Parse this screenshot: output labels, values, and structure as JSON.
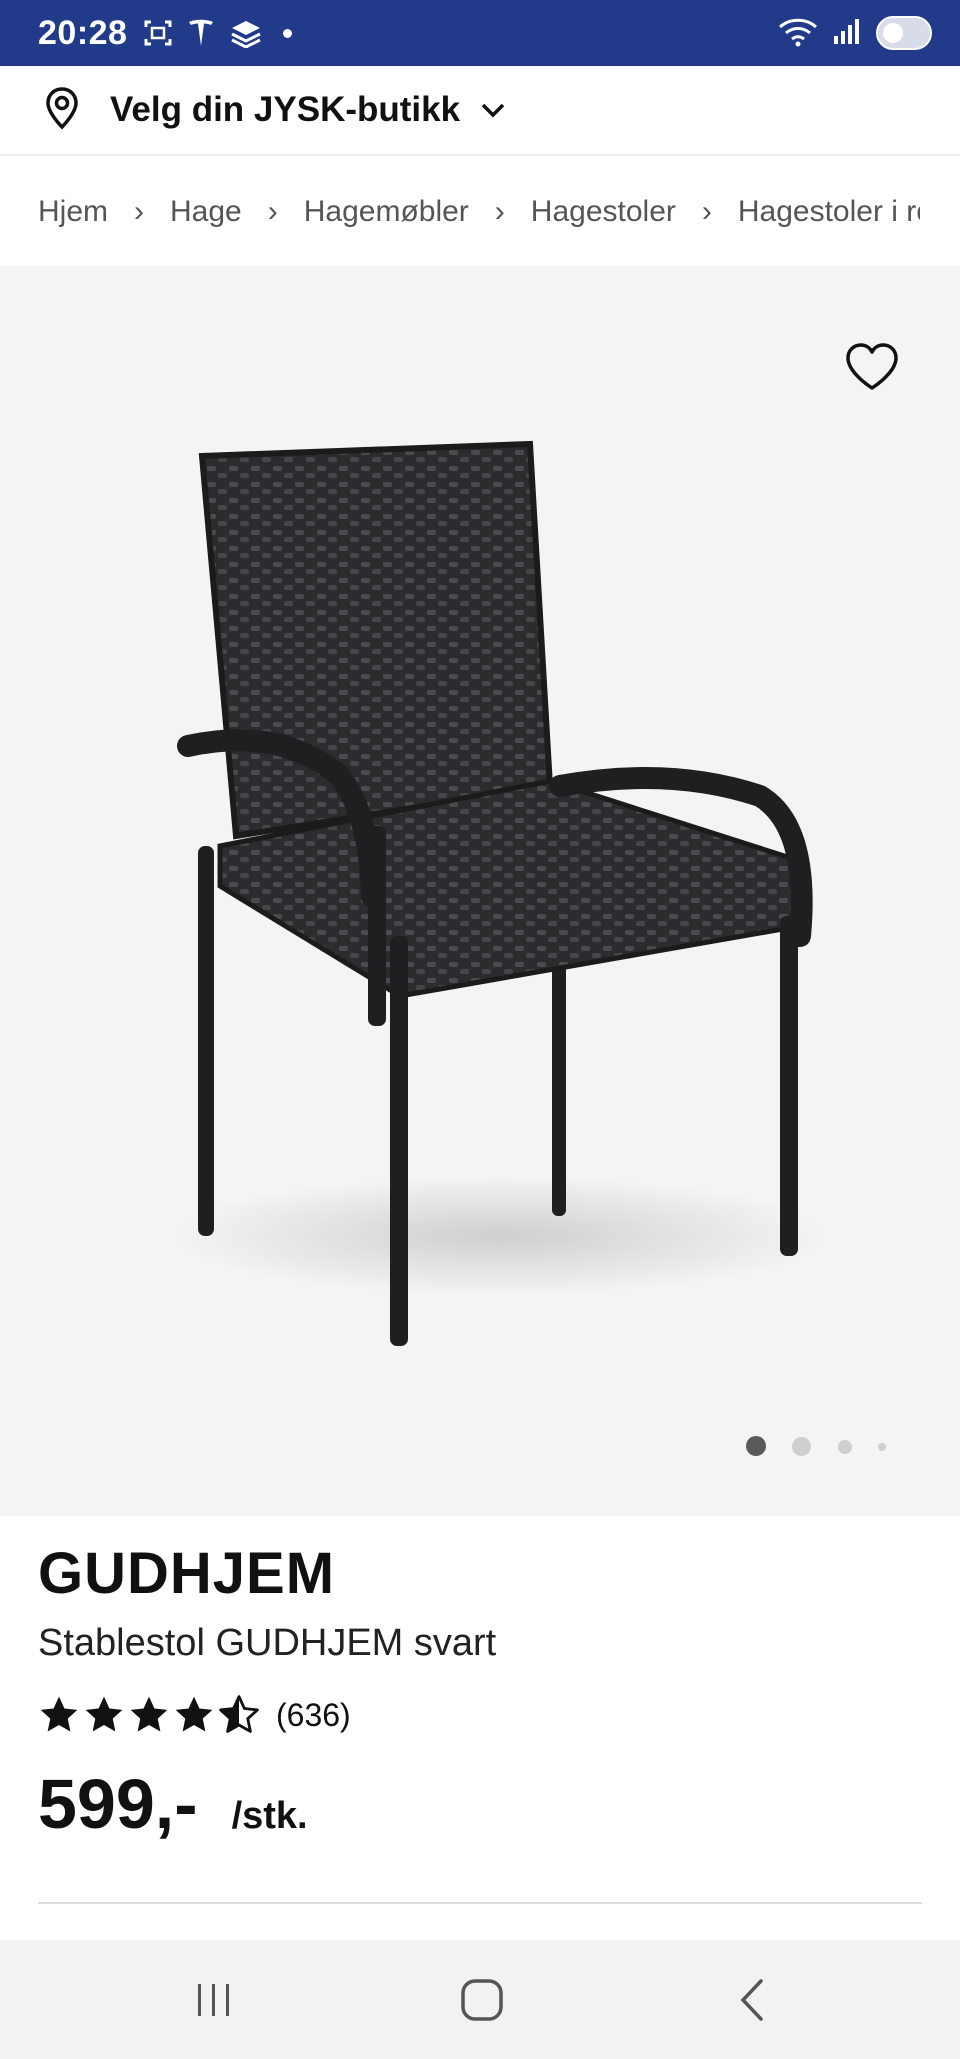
{
  "status_bar": {
    "time": "20:28",
    "icons_left": [
      "screenshot-icon",
      "tesla-icon",
      "app-icon",
      "notification-dot"
    ],
    "icons_right": [
      "wifi-icon",
      "signal-icon",
      "battery-toggle-icon"
    ],
    "background": "#213a8a"
  },
  "store_picker": {
    "label": "Velg din JYSK-butikk",
    "icon": "location-pin-icon"
  },
  "breadcrumb": {
    "items": [
      "Hjem",
      "Hage",
      "Hagemøbler",
      "Hagestoler",
      "Hagestoler i ro"
    ]
  },
  "gallery": {
    "image": "black wicker stacking armchair",
    "favorite_icon": "heart-outline-icon",
    "page_count": 4,
    "active_page": 1
  },
  "product": {
    "brand": "GUDHJEM",
    "name": "Stablestol GUDHJEM svart",
    "rating": 4.5,
    "rating_max": 5,
    "rating_count": "(636)",
    "price": "599,-",
    "price_unit": "/stk."
  },
  "navbar": {
    "items": [
      "recent-apps-icon",
      "home-icon",
      "back-icon"
    ]
  }
}
